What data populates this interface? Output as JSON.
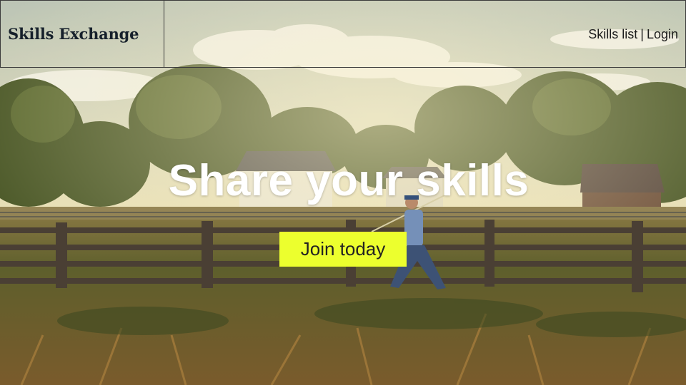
{
  "header": {
    "brand": "Skills Exchange",
    "nav": {
      "skills_list": "Skills list",
      "separator": "|",
      "login": "Login"
    }
  },
  "hero": {
    "title": "Share your skills",
    "cta": "Join today"
  },
  "background": {
    "image_icon": "farm-landscape-photo"
  },
  "colors": {
    "cta_background": "#ecff2e",
    "hero_text": "#ffffff",
    "header_border": "#3a3a3a"
  }
}
